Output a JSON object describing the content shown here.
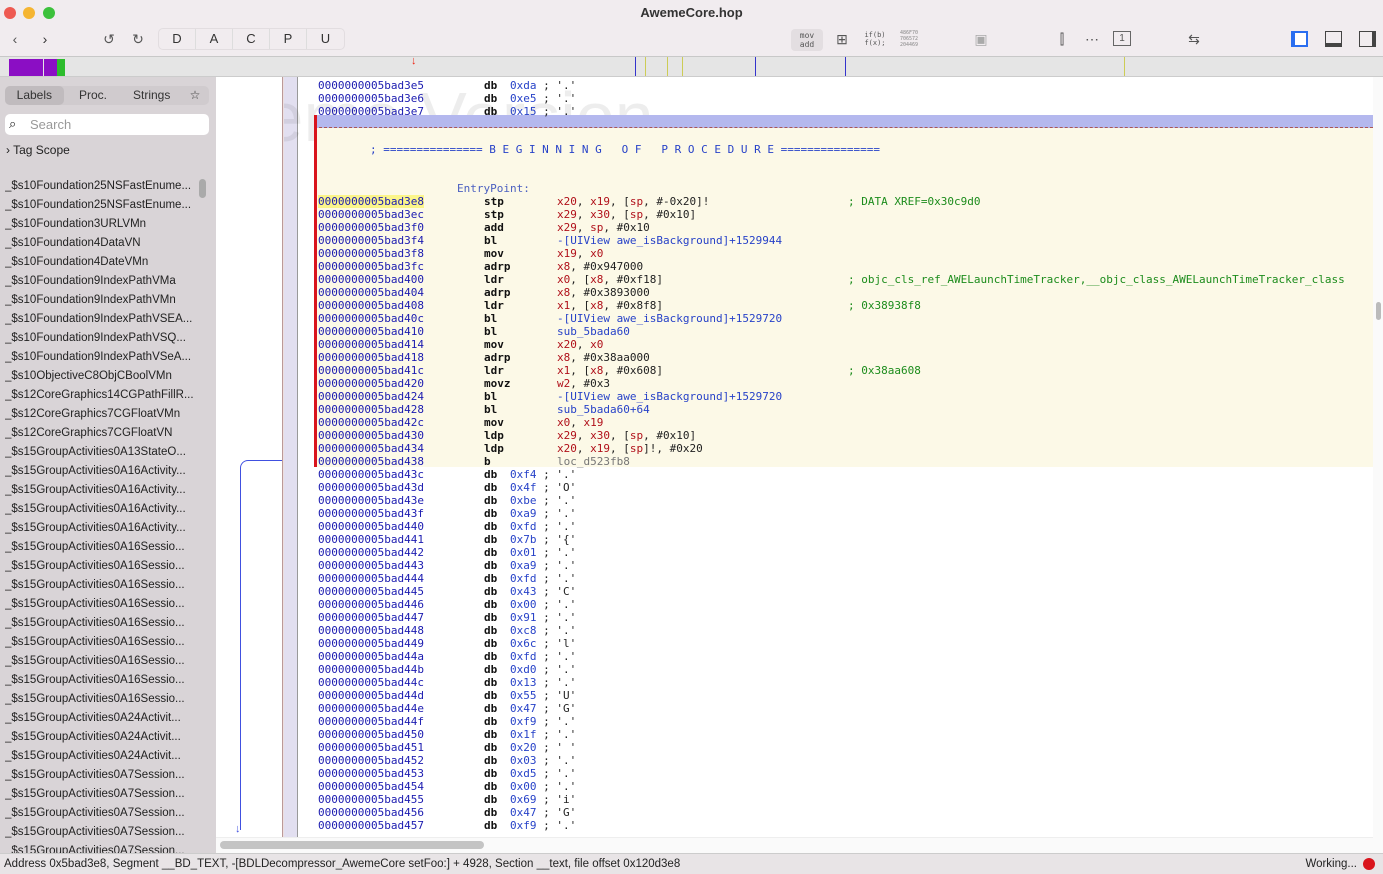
{
  "window": {
    "title": "AwemeCore.hop"
  },
  "toolbar": {
    "segments": [
      "D",
      "A",
      "C",
      "P",
      "U"
    ],
    "mov_add": "mov\nadd",
    "if_label": "if(b)\nf(x);",
    "hex_label": "486F70\n706572\n204469"
  },
  "sidebar": {
    "tabs": [
      "Labels",
      "Proc.",
      "Strings"
    ],
    "search_placeholder": "Search",
    "tag_scope": "Tag Scope",
    "items": [
      "_$s10Foundation25NSFastEnume...",
      "_$s10Foundation25NSFastEnume...",
      "_$s10Foundation3URLVMn",
      "_$s10Foundation4DataVN",
      "_$s10Foundation4DateVMn",
      "_$s10Foundation9IndexPathVMa",
      "_$s10Foundation9IndexPathVMn",
      "_$s10Foundation9IndexPathVSEA...",
      "_$s10Foundation9IndexPathVSQ...",
      "_$s10Foundation9IndexPathVSeA...",
      "_$s10ObjectiveC8ObjCBoolVMn",
      "_$s12CoreGraphics14CGPathFillR...",
      "_$s12CoreGraphics7CGFloatVMn",
      "_$s12CoreGraphics7CGFloatVN",
      "_$s15GroupActivities0A13StateO...",
      "_$s15GroupActivities0A16Activity...",
      "_$s15GroupActivities0A16Activity...",
      "_$s15GroupActivities0A16Activity...",
      "_$s15GroupActivities0A16Activity...",
      "_$s15GroupActivities0A16Sessio...",
      "_$s15GroupActivities0A16Sessio...",
      "_$s15GroupActivities0A16Sessio...",
      "_$s15GroupActivities0A16Sessio...",
      "_$s15GroupActivities0A16Sessio...",
      "_$s15GroupActivities0A16Sessio...",
      "_$s15GroupActivities0A16Sessio...",
      "_$s15GroupActivities0A16Sessio...",
      "_$s15GroupActivities0A16Sessio...",
      "_$s15GroupActivities0A24Activit...",
      "_$s15GroupActivities0A24Activit...",
      "_$s15GroupActivities0A24Activit...",
      "_$s15GroupActivities0A7Session...",
      "_$s15GroupActivities0A7Session...",
      "_$s15GroupActivities0A7Session...",
      "_$s15GroupActivities0A7Session...",
      "_$s15GroupActivities0A7Session..."
    ]
  },
  "code": {
    "watermark": "Demo Version",
    "pre_bytes": [
      [
        "0000000005bad3e5",
        "0xda",
        "'.'"
      ],
      [
        "0000000005bad3e6",
        "0xe5",
        "'.'"
      ],
      [
        "0000000005bad3e7",
        "0x15",
        "'.'"
      ]
    ],
    "banner": "; =============== B E G I N N I N G   O F   P R O C E D U R E ===============",
    "label": "EntryPoint:",
    "instructions": [
      [
        "0000000005bad3e8",
        "stp",
        "x20, x19, [sp, #-0x20]!",
        "; DATA XREF=0x30c9d0"
      ],
      [
        "0000000005bad3ec",
        "stp",
        "x29, x30, [sp, #0x10]",
        ""
      ],
      [
        "0000000005bad3f0",
        "add",
        "x29, sp, #0x10",
        ""
      ],
      [
        "0000000005bad3f4",
        "bl",
        "-[UIView awe_isBackground]+1529944",
        ""
      ],
      [
        "0000000005bad3f8",
        "mov",
        "x19, x0",
        ""
      ],
      [
        "0000000005bad3fc",
        "adrp",
        "x8, #0x947000",
        ""
      ],
      [
        "0000000005bad400",
        "ldr",
        "x0, [x8, #0xf18]",
        "; objc_cls_ref_AWELaunchTimeTracker,__objc_class_AWELaunchTimeTracker_class"
      ],
      [
        "0000000005bad404",
        "adrp",
        "x8, #0x3893000",
        ""
      ],
      [
        "0000000005bad408",
        "ldr",
        "x1, [x8, #0x8f8]",
        "; 0x38938f8"
      ],
      [
        "0000000005bad40c",
        "bl",
        "-[UIView awe_isBackground]+1529720",
        ""
      ],
      [
        "0000000005bad410",
        "bl",
        "sub_5bada60",
        ""
      ],
      [
        "0000000005bad414",
        "mov",
        "x20, x0",
        ""
      ],
      [
        "0000000005bad418",
        "adrp",
        "x8, #0x38aa000",
        ""
      ],
      [
        "0000000005bad41c",
        "ldr",
        "x1, [x8, #0x608]",
        "; 0x38aa608"
      ],
      [
        "0000000005bad420",
        "movz",
        "w2, #0x3",
        ""
      ],
      [
        "0000000005bad424",
        "bl",
        "-[UIView awe_isBackground]+1529720",
        ""
      ],
      [
        "0000000005bad428",
        "bl",
        "sub_5bada60+64",
        ""
      ],
      [
        "0000000005bad42c",
        "mov",
        "x0, x19",
        ""
      ],
      [
        "0000000005bad430",
        "ldp",
        "x29, x30, [sp, #0x10]",
        ""
      ],
      [
        "0000000005bad434",
        "ldp",
        "x20, x19, [sp]!, #0x20",
        ""
      ],
      [
        "0000000005bad438",
        "b",
        "loc_d523fb8",
        ""
      ]
    ],
    "post_bytes": [
      [
        "0000000005bad43c",
        "0xf4",
        "'.'"
      ],
      [
        "0000000005bad43d",
        "0x4f",
        "'O'"
      ],
      [
        "0000000005bad43e",
        "0xbe",
        "'.'"
      ],
      [
        "0000000005bad43f",
        "0xa9",
        "'.'"
      ],
      [
        "0000000005bad440",
        "0xfd",
        "'.'"
      ],
      [
        "0000000005bad441",
        "0x7b",
        "'{'"
      ],
      [
        "0000000005bad442",
        "0x01",
        "'.'"
      ],
      [
        "0000000005bad443",
        "0xa9",
        "'.'"
      ],
      [
        "0000000005bad444",
        "0xfd",
        "'.'"
      ],
      [
        "0000000005bad445",
        "0x43",
        "'C'"
      ],
      [
        "0000000005bad446",
        "0x00",
        "'.'"
      ],
      [
        "0000000005bad447",
        "0x91",
        "'.'"
      ],
      [
        "0000000005bad448",
        "0xc8",
        "'.'"
      ],
      [
        "0000000005bad449",
        "0x6c",
        "'l'"
      ],
      [
        "0000000005bad44a",
        "0xfd",
        "'.'"
      ],
      [
        "0000000005bad44b",
        "0xd0",
        "'.'"
      ],
      [
        "0000000005bad44c",
        "0x13",
        "'.'"
      ],
      [
        "0000000005bad44d",
        "0x55",
        "'U'"
      ],
      [
        "0000000005bad44e",
        "0x47",
        "'G'"
      ],
      [
        "0000000005bad44f",
        "0xf9",
        "'.'"
      ],
      [
        "0000000005bad450",
        "0x1f",
        "'.'"
      ],
      [
        "0000000005bad451",
        "0x20",
        "' '"
      ],
      [
        "0000000005bad452",
        "0x03",
        "'.'"
      ],
      [
        "0000000005bad453",
        "0xd5",
        "'.'"
      ],
      [
        "0000000005bad454",
        "0x00",
        "'.'"
      ],
      [
        "0000000005bad455",
        "0x69",
        "'i'"
      ],
      [
        "0000000005bad456",
        "0x47",
        "'G'"
      ],
      [
        "0000000005bad457",
        "0xf9",
        "'.'"
      ]
    ]
  },
  "status": {
    "text": "Address 0x5bad3e8, Segment __BD_TEXT, -[BDLDecompressor_AwemeCore setFoo:] + 4928, Section __text, file offset 0x120d3e8",
    "working": "Working..."
  },
  "colors": {
    "accent": "#2742c8",
    "proc_bg": "#fcf9e7",
    "nav_purple": "#8b0ec4",
    "nav_green": "#2cbc2c"
  }
}
